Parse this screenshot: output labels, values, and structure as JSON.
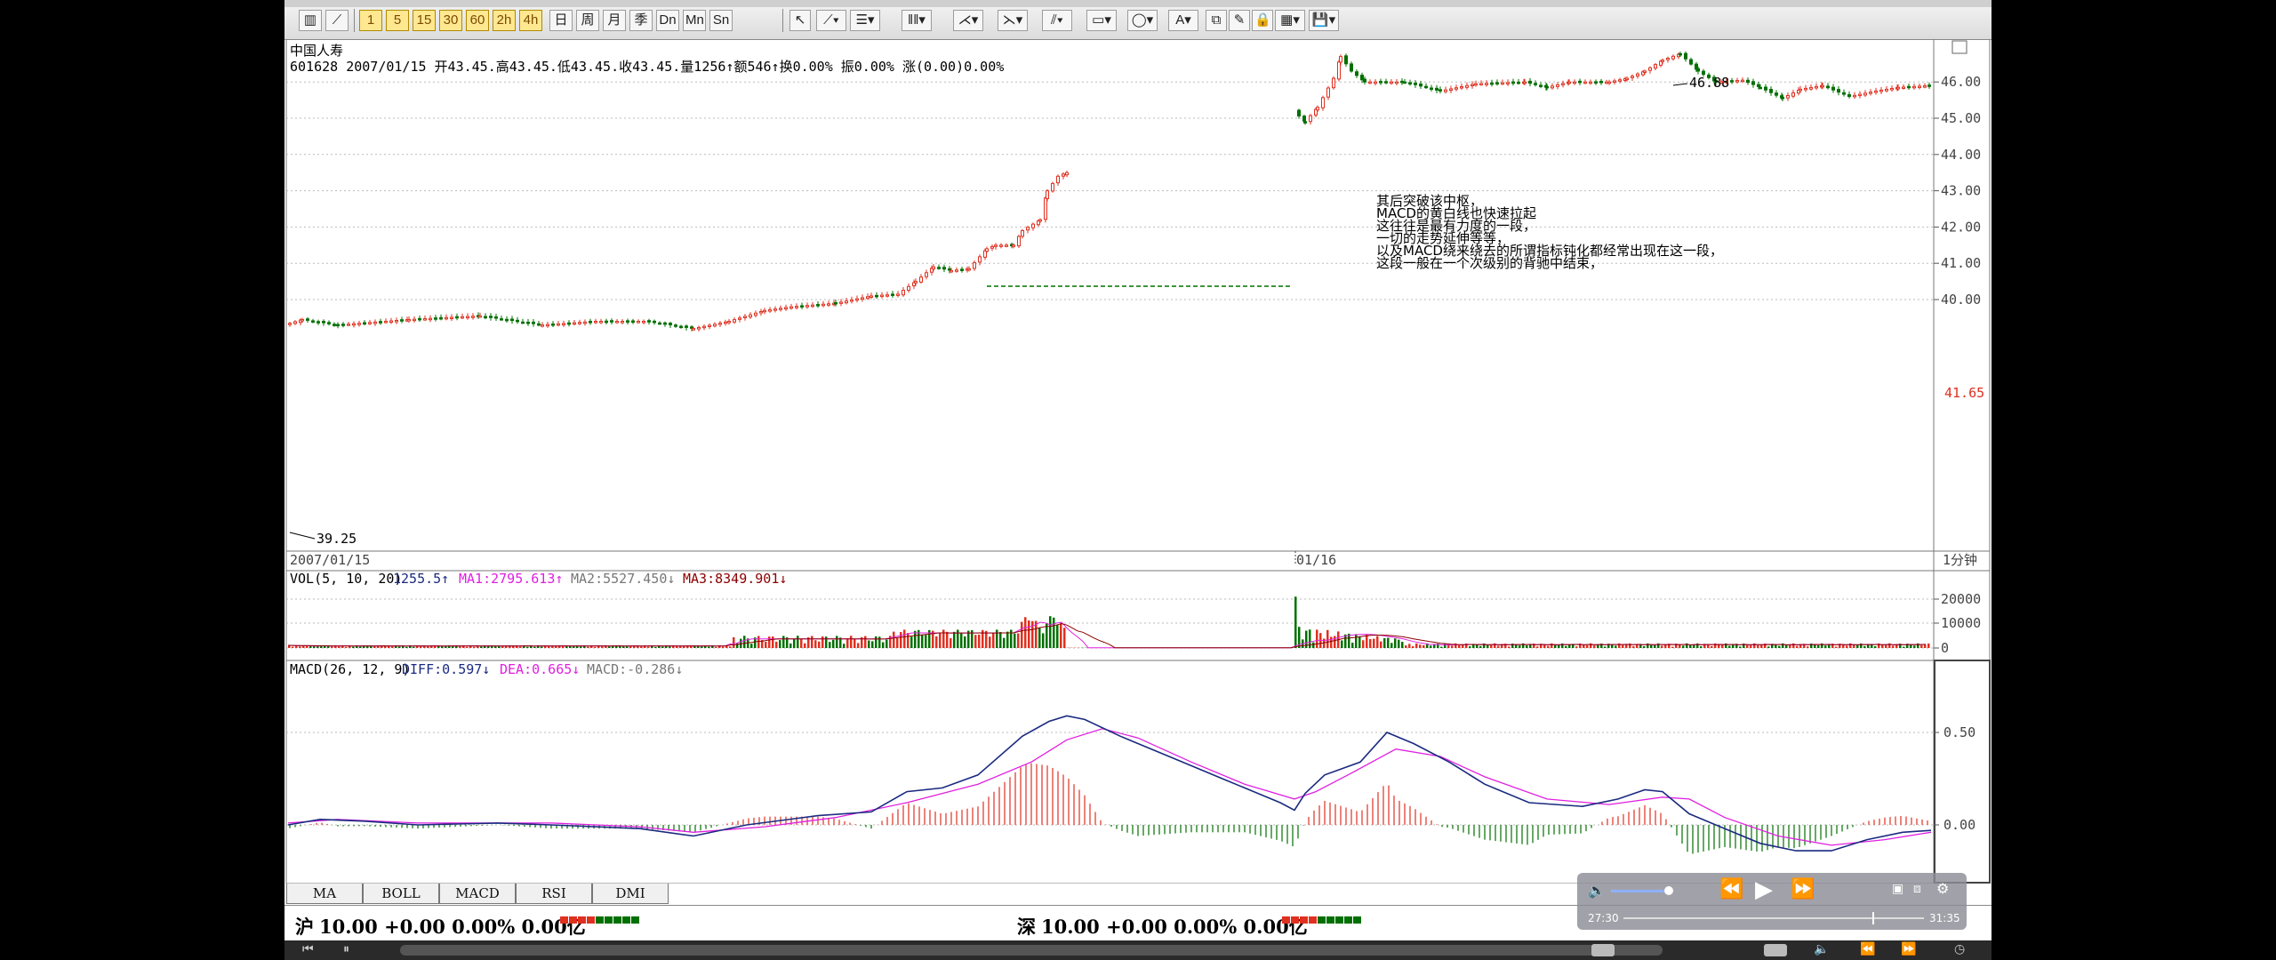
{
  "toolbar": {
    "period_buttons": [
      "日",
      "周",
      "月",
      "季",
      "Dn",
      "Mn",
      "Sn"
    ]
  },
  "stock": {
    "name": "中国人寿",
    "info_line": "601628 2007/01/15 开43.45.高43.45.低43.45.收43.45.量1256↑额546↑换0.00% 振0.00% 涨(0.00)0.00%",
    "period": "1分钟",
    "date_left": "2007/01/15",
    "date_mid": "01/16",
    "low_label": "39.25",
    "high_label": "46.88",
    "current_price": "41.65",
    "price_ticks": [
      "46.00",
      "45.00",
      "44.00",
      "43.00",
      "42.00",
      "41.00",
      "40.00"
    ]
  },
  "annotation": [
    "其后突破该中枢，",
    "MACD的黄白线也快速拉起",
    "这往往是最有力度的一段，",
    "一切的走势延伸等等，",
    "以及MACD绕来绕去的所谓指标钝化都经常出现在这一段，",
    "这段一般在一个次级别的背驰中结束，"
  ],
  "volume": {
    "label_name": "VOL(5, 10, 20)",
    "value": "1255.5↑",
    "ma1": "MA1:2795.613↑",
    "ma2": "MA2:5527.450↓",
    "ma3": "MA3:8349.901↓",
    "ticks": [
      "20000",
      "10000",
      "0"
    ]
  },
  "macd": {
    "label_name": "MACD(26, 12, 9)",
    "diff": "DIFF:0.597↓",
    "dea": "DEA:0.665↓",
    "macd": "MACD:-0.286↓",
    "ticks": [
      "0.50",
      "0.00"
    ]
  },
  "tabs": [
    "MA",
    "BOLL",
    "MACD",
    "RSI",
    "DMI"
  ],
  "status": {
    "sh_label": "沪",
    "sh_value": "10.00 +0.00 0.00% 0.00亿",
    "sz_label": "深",
    "sz_value": "10.00 +0.00 0.00% 0.00亿"
  },
  "player": {
    "time_current": "27:30",
    "time_total": "31:35"
  },
  "colors": {
    "up": "#e03020",
    "down": "#007000",
    "diff_line": "#1a2a80",
    "dea_line": "#e020e0",
    "grid": "#bbbbbb"
  }
}
